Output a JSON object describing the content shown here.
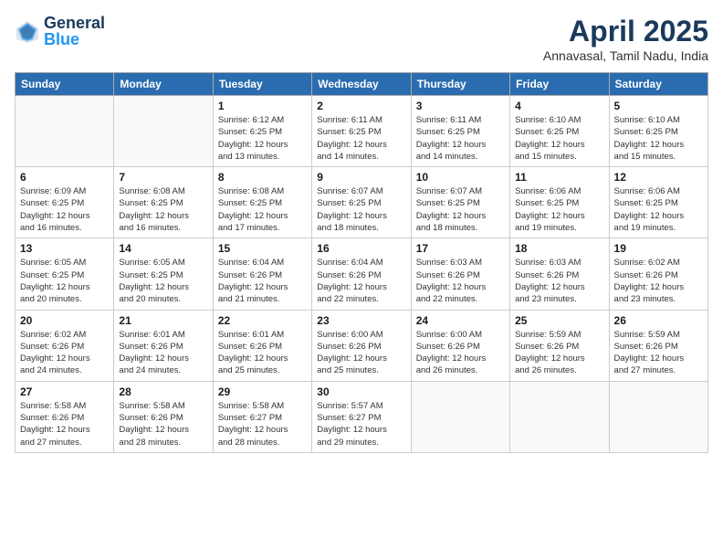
{
  "header": {
    "logo_line1": "General",
    "logo_line2": "Blue",
    "month_title": "April 2025",
    "subtitle": "Annavasal, Tamil Nadu, India"
  },
  "weekdays": [
    "Sunday",
    "Monday",
    "Tuesday",
    "Wednesday",
    "Thursday",
    "Friday",
    "Saturday"
  ],
  "weeks": [
    [
      {
        "day": "",
        "info": ""
      },
      {
        "day": "",
        "info": ""
      },
      {
        "day": "1",
        "info": "Sunrise: 6:12 AM\nSunset: 6:25 PM\nDaylight: 12 hours\nand 13 minutes."
      },
      {
        "day": "2",
        "info": "Sunrise: 6:11 AM\nSunset: 6:25 PM\nDaylight: 12 hours\nand 14 minutes."
      },
      {
        "day": "3",
        "info": "Sunrise: 6:11 AM\nSunset: 6:25 PM\nDaylight: 12 hours\nand 14 minutes."
      },
      {
        "day": "4",
        "info": "Sunrise: 6:10 AM\nSunset: 6:25 PM\nDaylight: 12 hours\nand 15 minutes."
      },
      {
        "day": "5",
        "info": "Sunrise: 6:10 AM\nSunset: 6:25 PM\nDaylight: 12 hours\nand 15 minutes."
      }
    ],
    [
      {
        "day": "6",
        "info": "Sunrise: 6:09 AM\nSunset: 6:25 PM\nDaylight: 12 hours\nand 16 minutes."
      },
      {
        "day": "7",
        "info": "Sunrise: 6:08 AM\nSunset: 6:25 PM\nDaylight: 12 hours\nand 16 minutes."
      },
      {
        "day": "8",
        "info": "Sunrise: 6:08 AM\nSunset: 6:25 PM\nDaylight: 12 hours\nand 17 minutes."
      },
      {
        "day": "9",
        "info": "Sunrise: 6:07 AM\nSunset: 6:25 PM\nDaylight: 12 hours\nand 18 minutes."
      },
      {
        "day": "10",
        "info": "Sunrise: 6:07 AM\nSunset: 6:25 PM\nDaylight: 12 hours\nand 18 minutes."
      },
      {
        "day": "11",
        "info": "Sunrise: 6:06 AM\nSunset: 6:25 PM\nDaylight: 12 hours\nand 19 minutes."
      },
      {
        "day": "12",
        "info": "Sunrise: 6:06 AM\nSunset: 6:25 PM\nDaylight: 12 hours\nand 19 minutes."
      }
    ],
    [
      {
        "day": "13",
        "info": "Sunrise: 6:05 AM\nSunset: 6:25 PM\nDaylight: 12 hours\nand 20 minutes."
      },
      {
        "day": "14",
        "info": "Sunrise: 6:05 AM\nSunset: 6:25 PM\nDaylight: 12 hours\nand 20 minutes."
      },
      {
        "day": "15",
        "info": "Sunrise: 6:04 AM\nSunset: 6:26 PM\nDaylight: 12 hours\nand 21 minutes."
      },
      {
        "day": "16",
        "info": "Sunrise: 6:04 AM\nSunset: 6:26 PM\nDaylight: 12 hours\nand 22 minutes."
      },
      {
        "day": "17",
        "info": "Sunrise: 6:03 AM\nSunset: 6:26 PM\nDaylight: 12 hours\nand 22 minutes."
      },
      {
        "day": "18",
        "info": "Sunrise: 6:03 AM\nSunset: 6:26 PM\nDaylight: 12 hours\nand 23 minutes."
      },
      {
        "day": "19",
        "info": "Sunrise: 6:02 AM\nSunset: 6:26 PM\nDaylight: 12 hours\nand 23 minutes."
      }
    ],
    [
      {
        "day": "20",
        "info": "Sunrise: 6:02 AM\nSunset: 6:26 PM\nDaylight: 12 hours\nand 24 minutes."
      },
      {
        "day": "21",
        "info": "Sunrise: 6:01 AM\nSunset: 6:26 PM\nDaylight: 12 hours\nand 24 minutes."
      },
      {
        "day": "22",
        "info": "Sunrise: 6:01 AM\nSunset: 6:26 PM\nDaylight: 12 hours\nand 25 minutes."
      },
      {
        "day": "23",
        "info": "Sunrise: 6:00 AM\nSunset: 6:26 PM\nDaylight: 12 hours\nand 25 minutes."
      },
      {
        "day": "24",
        "info": "Sunrise: 6:00 AM\nSunset: 6:26 PM\nDaylight: 12 hours\nand 26 minutes."
      },
      {
        "day": "25",
        "info": "Sunrise: 5:59 AM\nSunset: 6:26 PM\nDaylight: 12 hours\nand 26 minutes."
      },
      {
        "day": "26",
        "info": "Sunrise: 5:59 AM\nSunset: 6:26 PM\nDaylight: 12 hours\nand 27 minutes."
      }
    ],
    [
      {
        "day": "27",
        "info": "Sunrise: 5:58 AM\nSunset: 6:26 PM\nDaylight: 12 hours\nand 27 minutes."
      },
      {
        "day": "28",
        "info": "Sunrise: 5:58 AM\nSunset: 6:26 PM\nDaylight: 12 hours\nand 28 minutes."
      },
      {
        "day": "29",
        "info": "Sunrise: 5:58 AM\nSunset: 6:27 PM\nDaylight: 12 hours\nand 28 minutes."
      },
      {
        "day": "30",
        "info": "Sunrise: 5:57 AM\nSunset: 6:27 PM\nDaylight: 12 hours\nand 29 minutes."
      },
      {
        "day": "",
        "info": ""
      },
      {
        "day": "",
        "info": ""
      },
      {
        "day": "",
        "info": ""
      }
    ]
  ]
}
